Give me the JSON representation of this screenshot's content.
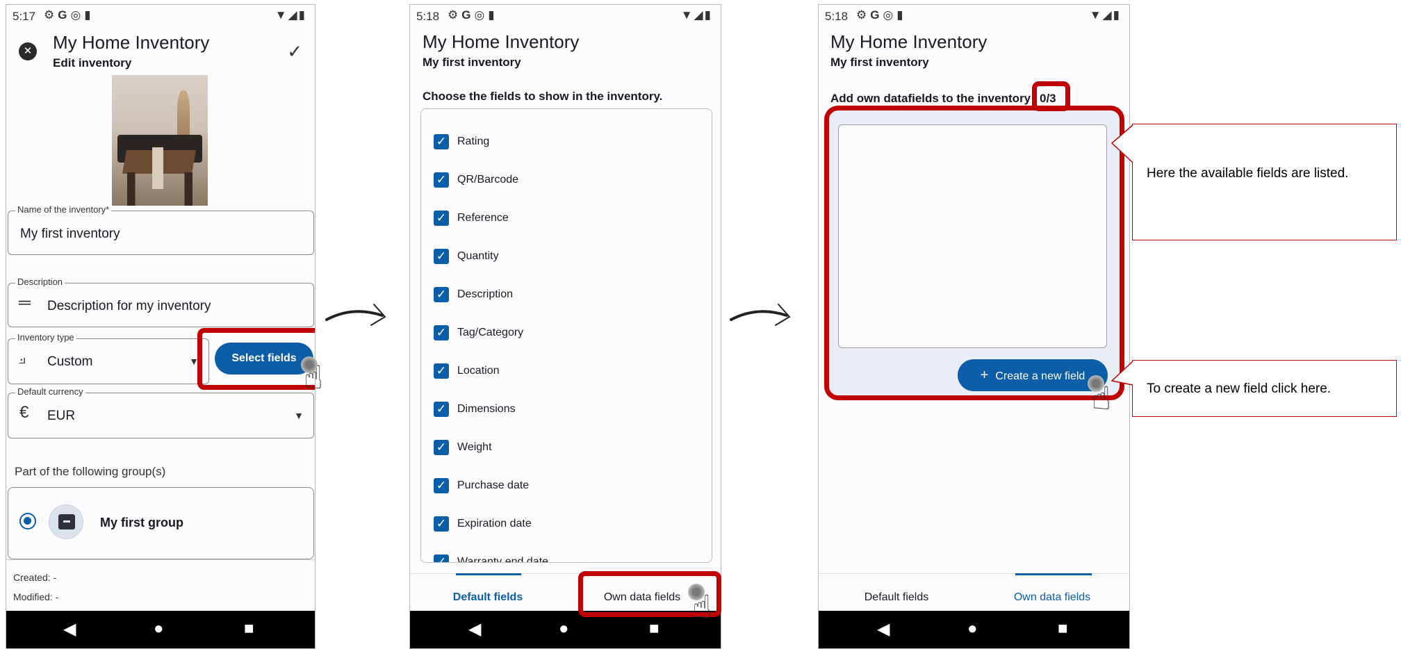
{
  "status": {
    "time_1": "5:17",
    "time_2": "5:18",
    "time_3": "5:18",
    "left_icons": "⚙G◎▮",
    "right_icons": "▼◢▮"
  },
  "app": {
    "title": "My Home Inventory"
  },
  "screen1": {
    "subtitle": "Edit inventory",
    "close_icon": "✕",
    "confirm_icon": "✓",
    "name_label": "Name of the inventory*",
    "name_value": "My first inventory",
    "description_label": "Description",
    "description_value": "Description for my inventory",
    "type_label": "Inventory type",
    "type_value": "Custom",
    "select_fields_label": "Select fields",
    "currency_label": "Default currency",
    "currency_value": "EUR",
    "groups_heading": "Part of the following group(s)",
    "group_name": "My first group",
    "created_label": "Created: -",
    "modified_label": "Modified: -"
  },
  "screen2": {
    "subtitle": "My first inventory",
    "instruction": "Choose the fields to show in the inventory.",
    "fields": [
      {
        "label": "Rating"
      },
      {
        "label": "QR/Barcode"
      },
      {
        "label": "Reference"
      },
      {
        "label": "Quantity"
      },
      {
        "label": "Description"
      },
      {
        "label": "Tag/Category"
      },
      {
        "label": "Location"
      },
      {
        "label": "Dimensions"
      },
      {
        "label": "Weight"
      },
      {
        "label": "Purchase date"
      },
      {
        "label": "Expiration date"
      },
      {
        "label": "Warranty end date"
      }
    ],
    "tab_default": "Default fields",
    "tab_own": "Own data fields"
  },
  "screen3": {
    "subtitle": "My first inventory",
    "instruction": "Add own datafields to the inventory",
    "count": "0/3",
    "create_button": "Create a new field",
    "plus_icon": "+",
    "tab_default": "Default fields",
    "tab_own": "Own data fields"
  },
  "callouts": {
    "available_fields": "Here the available fields are listed.",
    "create_field": "To create a new field click here."
  },
  "colors": {
    "accent": "#0d5ea8",
    "highlight": "#c00000"
  }
}
